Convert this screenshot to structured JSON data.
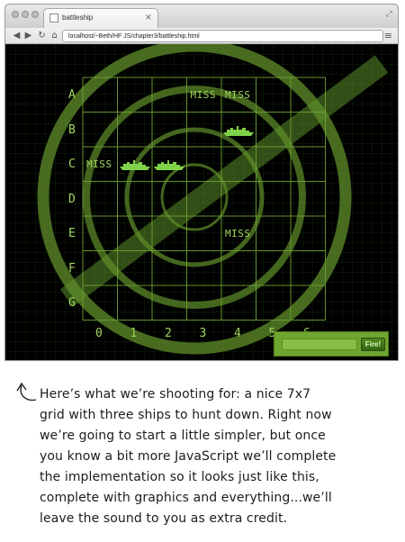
{
  "browser": {
    "tab_title": "battleship",
    "tab_close": "×",
    "url": "localhost/~Beth/HF JS/chapter3/battleship.html",
    "back_icon": "◀",
    "forward_icon": "▶",
    "reload_icon": "↻",
    "home_icon": "⌂",
    "menu_icon": "≡",
    "resize_icon": "⤢"
  },
  "game": {
    "rows": [
      "A",
      "B",
      "C",
      "D",
      "E",
      "F",
      "G"
    ],
    "columns": [
      "0",
      "1",
      "2",
      "3",
      "4",
      "5",
      "6"
    ],
    "misses": [
      {
        "row": "A",
        "col": 3,
        "label": "MISS"
      },
      {
        "row": "A",
        "col": 4,
        "label": "MISS"
      },
      {
        "row": "C",
        "col": 0,
        "label": "MISS"
      },
      {
        "row": "E",
        "col": 4,
        "label": "MISS"
      }
    ],
    "hits": [
      {
        "row": "B",
        "col": 4
      },
      {
        "row": "C",
        "col": 1
      },
      {
        "row": "C",
        "col": 2
      }
    ],
    "guess_placeholder": "",
    "fire_label": "Fire!"
  },
  "caption": {
    "lines": [
      "Here’s what we’re shooting for: a nice 7x7",
      "grid with three ships to hunt down. Right now",
      "we’re going to start a little simpler, but once",
      "you know a bit more JavaScript we’ll complete",
      "the implementation so it looks just like this,",
      "complete with graphics and everything...we’ll",
      "leave the sound to you as extra credit."
    ]
  },
  "colors": {
    "radar_green": "#6fa032",
    "text_green": "#a2d760",
    "ship_green": "#7fd24a",
    "background": "#000000"
  }
}
